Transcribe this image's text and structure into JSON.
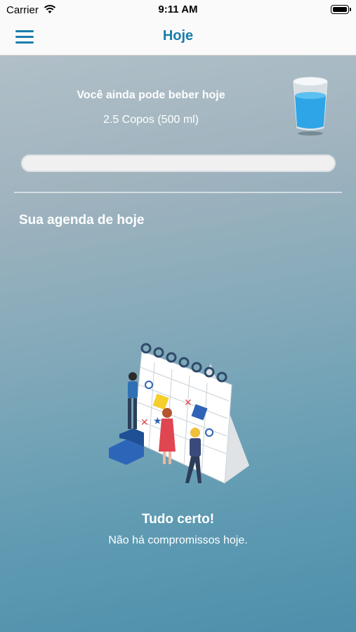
{
  "status_bar": {
    "carrier": "Carrier",
    "time": "9:11 AM"
  },
  "navbar": {
    "title": "Hoje",
    "menu_icon": "hamburger-menu-icon"
  },
  "water": {
    "title": "Você ainda pode beber hoje",
    "remaining": "2.5 Copos (500 ml)",
    "glass_icon": "water-glass-icon",
    "progress_fraction": 0.0
  },
  "agenda": {
    "title": "Sua agenda de hoje",
    "empty_title": "Tudo certo!",
    "empty_message": "Não há compromissos hoje.",
    "illustration": "calendar-people-illustration"
  },
  "colors": {
    "accent": "#1a7dab",
    "water": "#2ea5e6"
  }
}
